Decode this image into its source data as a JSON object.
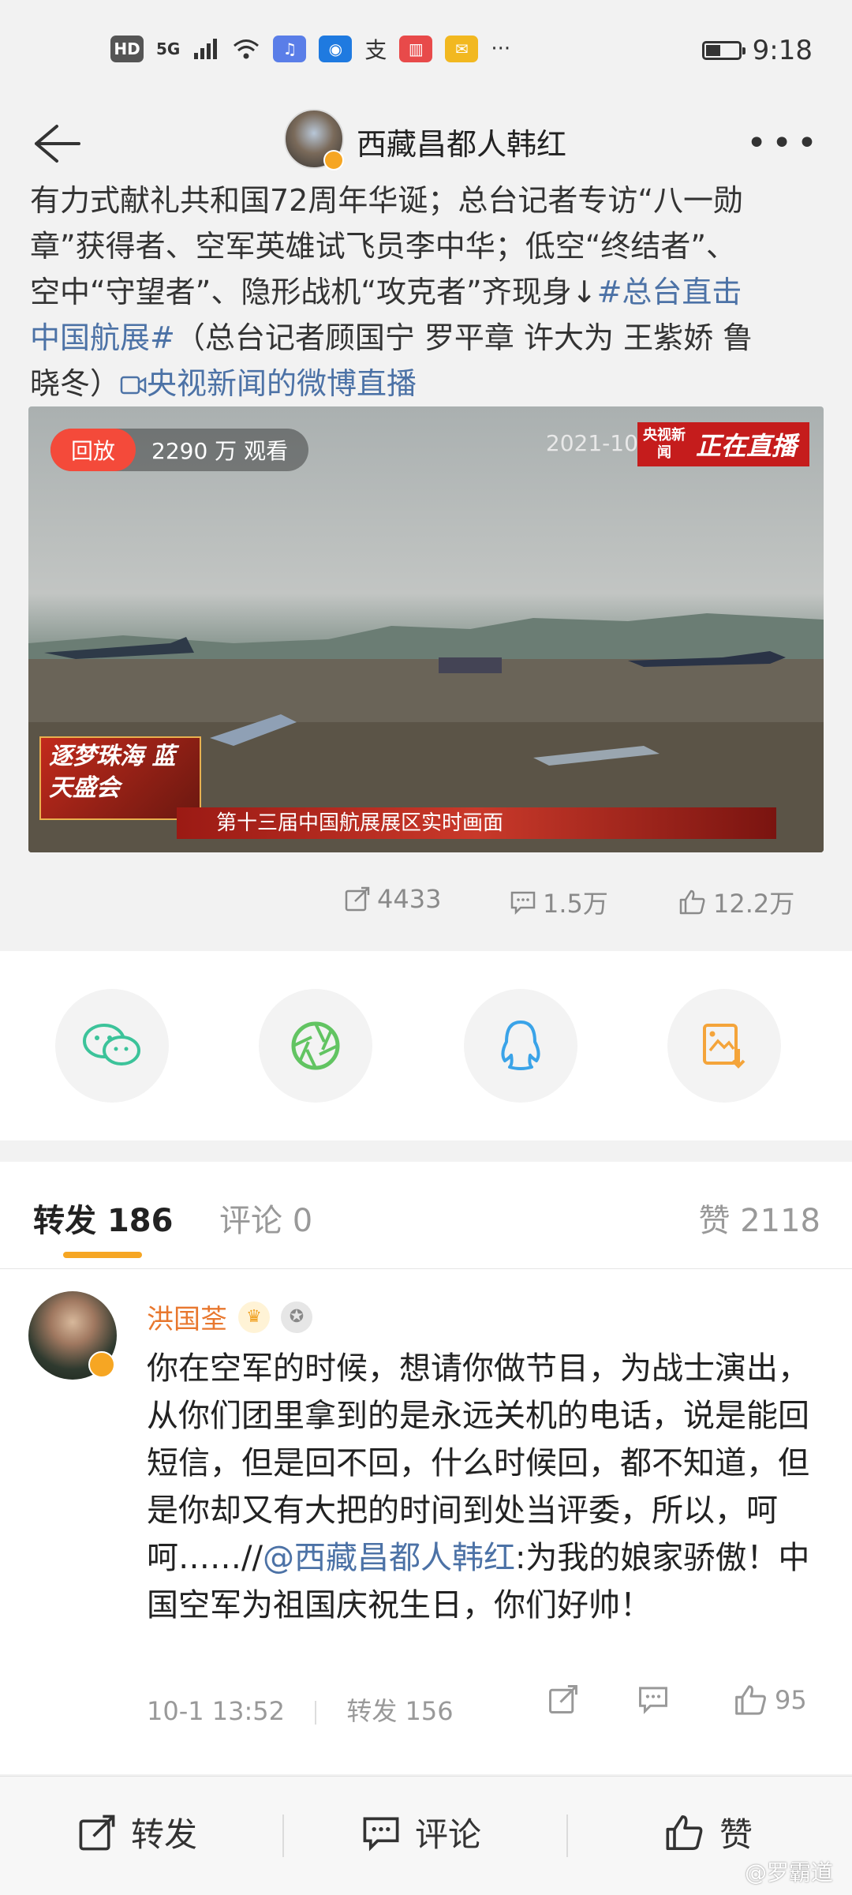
{
  "status_bar": {
    "time": "9:18",
    "hd_label": "HD",
    "network_label": "5G",
    "alipay_label": "支",
    "more_label": "···",
    "battery_level": 0.45
  },
  "header": {
    "title": "西藏昌都人韩红",
    "more_label": "•••"
  },
  "post": {
    "text_line1": "有力式献礼共和国72周年华诞；总台记者专访“八一勋",
    "text_line2": "章”获得者、空军英雄试飞员李中华；低空“终结者”、",
    "text_line3_pre": "空中“守望者”、隐形战机“攻克者”齐现身↓",
    "text_line3_tag": "#总台直击",
    "text_line4_tag": "中国航展#",
    "text_line4_post": "（总台记者顾国宁 罗平章 许大为 王紫娇 鲁",
    "text_line5_post": "晓冬）",
    "live_link": "央视新闻的微博直播"
  },
  "video": {
    "replay_label": "回放",
    "view_count": "2290 万 观看",
    "date": "2021-10-",
    "live_logo_small": "央视新闻",
    "live_logo_big": "正在直播",
    "caption": "第十三届中国航展展区实时画面",
    "event_logo": "逐梦珠海 蓝天盛会"
  },
  "stats": {
    "reposts": "4433",
    "comments": "1.5万",
    "likes": "12.2万"
  },
  "tabs": {
    "repost_label": "转发",
    "repost_count": "186",
    "comment_label": "评论",
    "comment_count": "0",
    "like_label": "赞",
    "like_count": "2118"
  },
  "comment": {
    "author": "洪国荃",
    "body_pre": "你在空军的时候，想请你做节目，为战士演出，从你们团里拿到的是永远关机的电话，说是能回短信，但是回不回，什么时候回，都不知道，但是你却又有大把的时间到处当评委，所以，呵呵……//",
    "mention": "@西藏昌都人韩红",
    "body_post": ":为我的娘家骄傲！中国空军为祖国庆祝生日，你们好帅！",
    "time": "10-1 13:52",
    "repost_text": "转发 156",
    "like_count": "95"
  },
  "bottom_bar": {
    "repost_label": "转发",
    "comment_label": "评论",
    "like_label": "赞",
    "watermark": "@罗霸道"
  },
  "colors": {
    "accent_orange": "#f6a623",
    "link_blue": "#4c72a6",
    "name_orange": "#e8772e",
    "live_red": "#c51c1c",
    "wechat_green": "#3cc39a",
    "moments_green": "#62c462",
    "qq_blue": "#3aa3e8",
    "save_orange": "#f4a43a"
  }
}
